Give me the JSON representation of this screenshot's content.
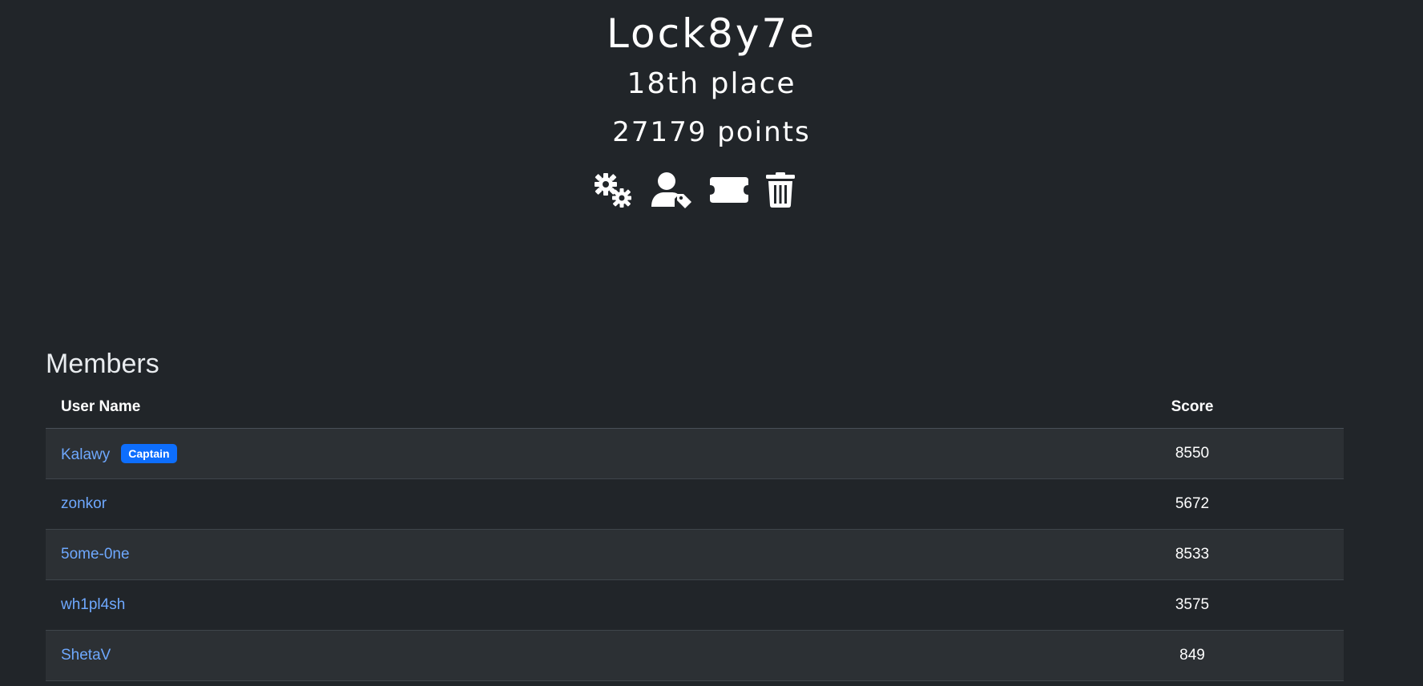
{
  "team": {
    "name": "Lock8y7e",
    "place": "18th place",
    "points": "27179 points"
  },
  "actions": [
    {
      "icon": "gears-icon"
    },
    {
      "icon": "user-tag-icon"
    },
    {
      "icon": "ticket-icon"
    },
    {
      "icon": "trash-icon"
    }
  ],
  "members": {
    "title": "Members",
    "columns": {
      "user_name": "User Name",
      "score": "Score"
    },
    "rows": [
      {
        "name": "Kalawy",
        "badge": "Captain",
        "score": "8550"
      },
      {
        "name": "zonkor",
        "badge": "",
        "score": "5672"
      },
      {
        "name": "5ome-0ne",
        "badge": "",
        "score": "8533"
      },
      {
        "name": "wh1pl4sh",
        "badge": "",
        "score": "3575"
      },
      {
        "name": "ShetaV",
        "badge": "",
        "score": "849"
      }
    ]
  },
  "colors": {
    "background": "#212529",
    "link": "#6ea8fe",
    "badge": "#0d6efd",
    "striped_row": "#2c3034"
  }
}
